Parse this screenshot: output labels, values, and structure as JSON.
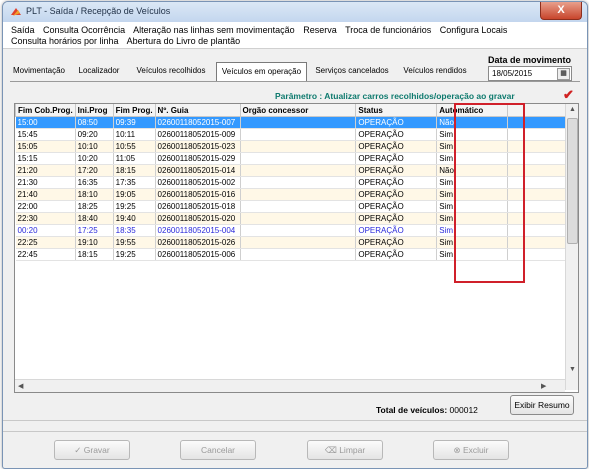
{
  "window": {
    "title": "PLT - Saída / Recepção de Veículos",
    "close_label": "X"
  },
  "menu": {
    "row1": [
      "Saída",
      "Consulta Ocorrência",
      "Alteração nas linhas sem movimentação",
      "Reserva",
      "Troca de funcionários",
      "Configura Locais"
    ],
    "row2": [
      "Consulta horários por linha",
      "Abertura do Livro de plantão"
    ]
  },
  "tabs": [
    "Movimentação",
    "Localizador",
    "Veículos recolhidos",
    "Veículos em operação",
    "Serviços cancelados",
    "Veículos rendidos"
  ],
  "active_tab": "Veículos em operação",
  "date": {
    "label": "Data de movimento",
    "value": "18/05/2015"
  },
  "parameter_text": "Parâmetro : Atualizar carros recolhidos/operação ao gravar",
  "table": {
    "columns": [
      "Fim Cob.Prog.",
      "Ini.Prog",
      "Fim Prog.",
      "Nº. Guia",
      "Orgão concessor",
      "Status",
      "Automático"
    ],
    "rows": [
      [
        "15:00",
        "08:50",
        "09:39",
        "02600118052015-007",
        "",
        "OPERAÇÃO",
        "Não"
      ],
      [
        "15:45",
        "09:20",
        "10:11",
        "02600118052015-009",
        "",
        "OPERAÇÃO",
        "Sim"
      ],
      [
        "15:05",
        "10:10",
        "10:55",
        "02600118052015-023",
        "",
        "OPERAÇÃO",
        "Sim"
      ],
      [
        "15:15",
        "10:20",
        "11:05",
        "02600118052015-029",
        "",
        "OPERAÇÃO",
        "Sim"
      ],
      [
        "21:20",
        "17:20",
        "18:15",
        "02600118052015-014",
        "",
        "OPERAÇÃO",
        "Não"
      ],
      [
        "21:30",
        "16:35",
        "17:35",
        "02600118052015-002",
        "",
        "OPERAÇÃO",
        "Sim"
      ],
      [
        "21:40",
        "18:10",
        "19:05",
        "02600118052015-016",
        "",
        "OPERAÇÃO",
        "Sim"
      ],
      [
        "22:00",
        "18:25",
        "19:25",
        "02600118052015-018",
        "",
        "OPERAÇÃO",
        "Sim"
      ],
      [
        "22:30",
        "18:40",
        "19:40",
        "02600118052015-020",
        "",
        "OPERAÇÃO",
        "Sim"
      ],
      [
        "00:20",
        "17:25",
        "18:35",
        "02600118052015-004",
        "",
        "OPERAÇÃO",
        "Sim"
      ],
      [
        "22:25",
        "19:10",
        "19:55",
        "02600118052015-026",
        "",
        "OPERAÇÃO",
        "Sim"
      ],
      [
        "22:45",
        "18:15",
        "19:25",
        "02600118052015-006",
        "",
        "OPERAÇÃO",
        "Sim"
      ]
    ]
  },
  "total": {
    "label": "Total de veículos:",
    "value": "000012"
  },
  "buttons": {
    "exibir_resumo": "Exibir Resumo",
    "gravar": "Gravar",
    "cancelar": "Cancelar",
    "limpar": "Limpar",
    "excluir": "Excluir"
  },
  "colors": {
    "selected_row": "#3399ff",
    "alt_row": "#fff8e7",
    "highlight_box": "#d0202a",
    "parameter_text": "#0e7a6e",
    "blue_row_text": "#2a2adb"
  }
}
